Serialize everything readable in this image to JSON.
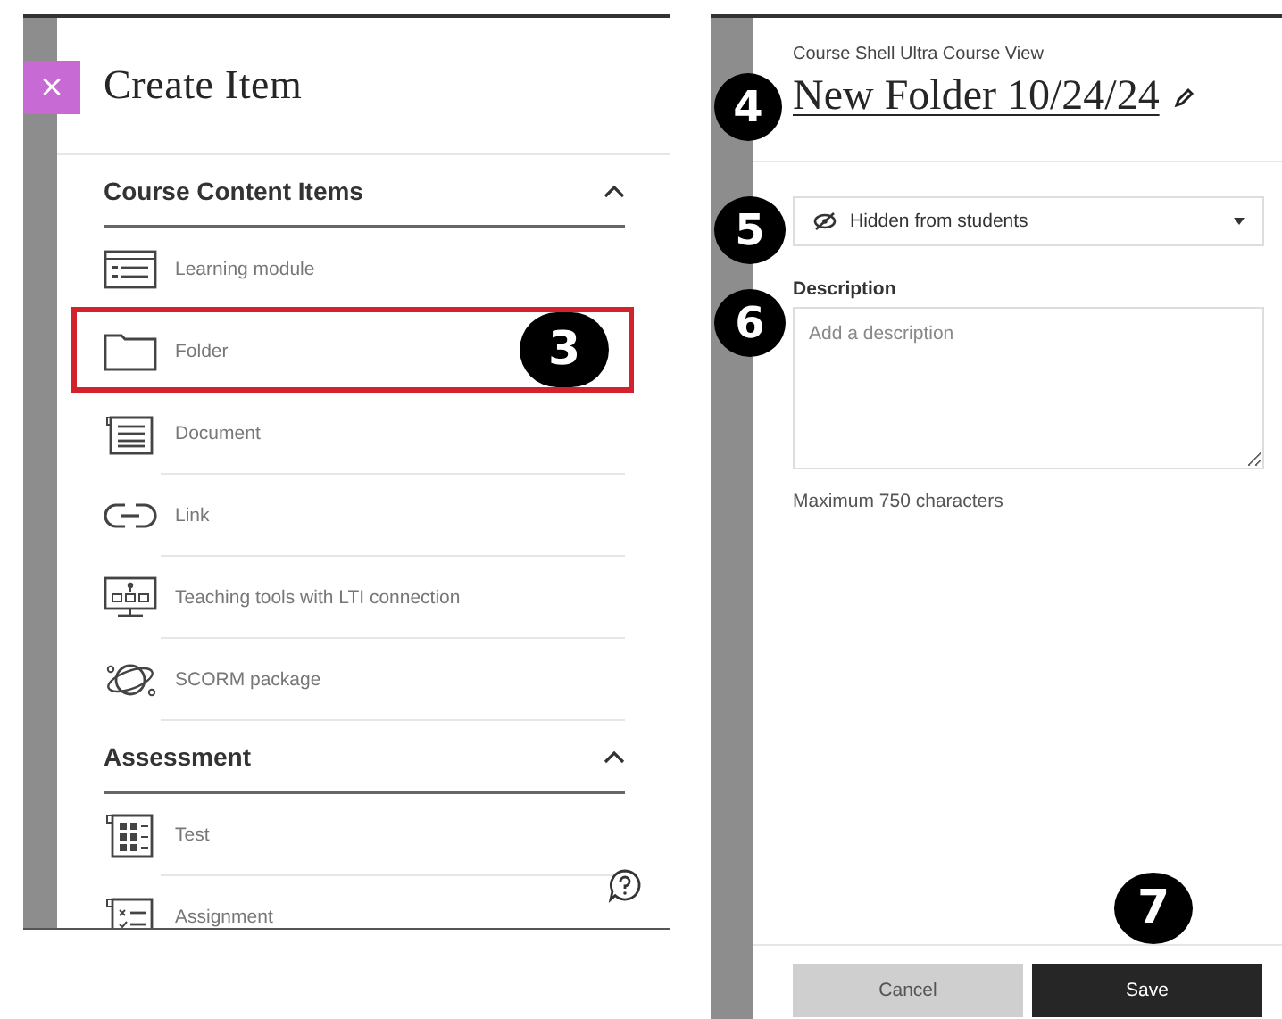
{
  "create_panel": {
    "close_icon": "×",
    "title": "Create Item",
    "sections": [
      {
        "title": "Course Content Items",
        "expanded": true,
        "items": [
          {
            "label": "Learning module",
            "kind": "module",
            "highlighted": false
          },
          {
            "label": "Folder",
            "kind": "folder",
            "highlighted": true,
            "callout": "3"
          },
          {
            "label": "Document",
            "kind": "document",
            "highlighted": false
          },
          {
            "label": "Link",
            "kind": "link",
            "highlighted": false
          },
          {
            "label": "Teaching tools with LTI connection",
            "kind": "lti",
            "highlighted": false
          },
          {
            "label": "SCORM package",
            "kind": "scorm",
            "highlighted": false
          }
        ]
      },
      {
        "title": "Assessment",
        "expanded": true,
        "items": [
          {
            "label": "Test",
            "kind": "test",
            "highlighted": false
          },
          {
            "label": "Assignment",
            "kind": "assignment",
            "highlighted": false
          }
        ]
      }
    ]
  },
  "folder_panel": {
    "breadcrumb": "Course Shell Ultra Course View",
    "title": "New Folder 10/24/24",
    "title_callout": "4",
    "visibility": {
      "value": "Hidden from students",
      "callout": "5"
    },
    "description": {
      "label": "Description",
      "placeholder": "Add a description",
      "callout": "6",
      "hint": "Maximum 750 characters"
    },
    "buttons": [
      {
        "label": "Cancel",
        "kind": "secondary"
      },
      {
        "label": "Save",
        "kind": "primary",
        "callout": "7"
      }
    ]
  }
}
